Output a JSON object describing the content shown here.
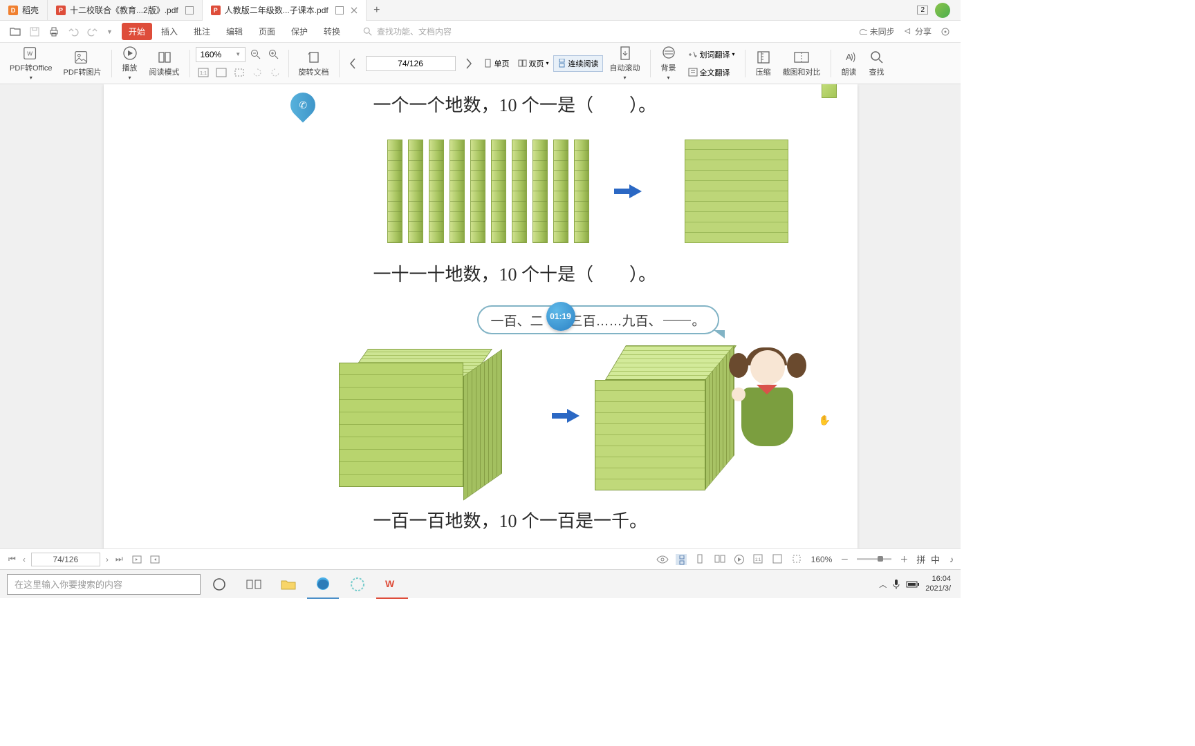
{
  "tabs": [
    {
      "label": "稻壳"
    },
    {
      "label": "十二校联合《教育...2版》.pdf"
    },
    {
      "label": "人教版二年级数...子课本.pdf"
    }
  ],
  "notif_count": "2",
  "quickbar": {
    "sync": "未同步",
    "share": "分享"
  },
  "menu": {
    "start": "开始",
    "insert": "插入",
    "annotate": "批注",
    "edit": "编辑",
    "page": "页面",
    "protect": "保护",
    "convert": "转换",
    "search_placeholder": "查找功能、文档内容"
  },
  "toolbar": {
    "to_office": "PDF转Office",
    "to_image": "PDF转图片",
    "play": "播放",
    "reading": "阅读模式",
    "zoom": "160%",
    "rotate": "旋转文档",
    "page_nav": "74/126",
    "single_page": "单页",
    "double_page": "双页",
    "continuous": "连续阅读",
    "auto_scroll": "自动滚动",
    "background": "背景",
    "word_translate": "划词翻译",
    "full_translate": "全文翻译",
    "compress": "压缩",
    "snip_compare": "截图和对比",
    "read_aloud": "朗读",
    "find": "查找"
  },
  "content": {
    "line1": "一个一个地数，10 个一是（　　）。",
    "line2": "一十一十地数，10 个十是（　　）。",
    "bubble_pre": "一百、二",
    "bubble_post": "三百……九百、",
    "bubble_period": "。",
    "line3": "一百一百地数，10 个一百是一千。",
    "timer": "01:19"
  },
  "status": {
    "page": "74/126",
    "zoom": "160%",
    "ime": "拼 中"
  },
  "taskbar": {
    "search_placeholder": "在这里输入你要搜索的内容",
    "time": "16:04",
    "date": "2021/3/"
  }
}
